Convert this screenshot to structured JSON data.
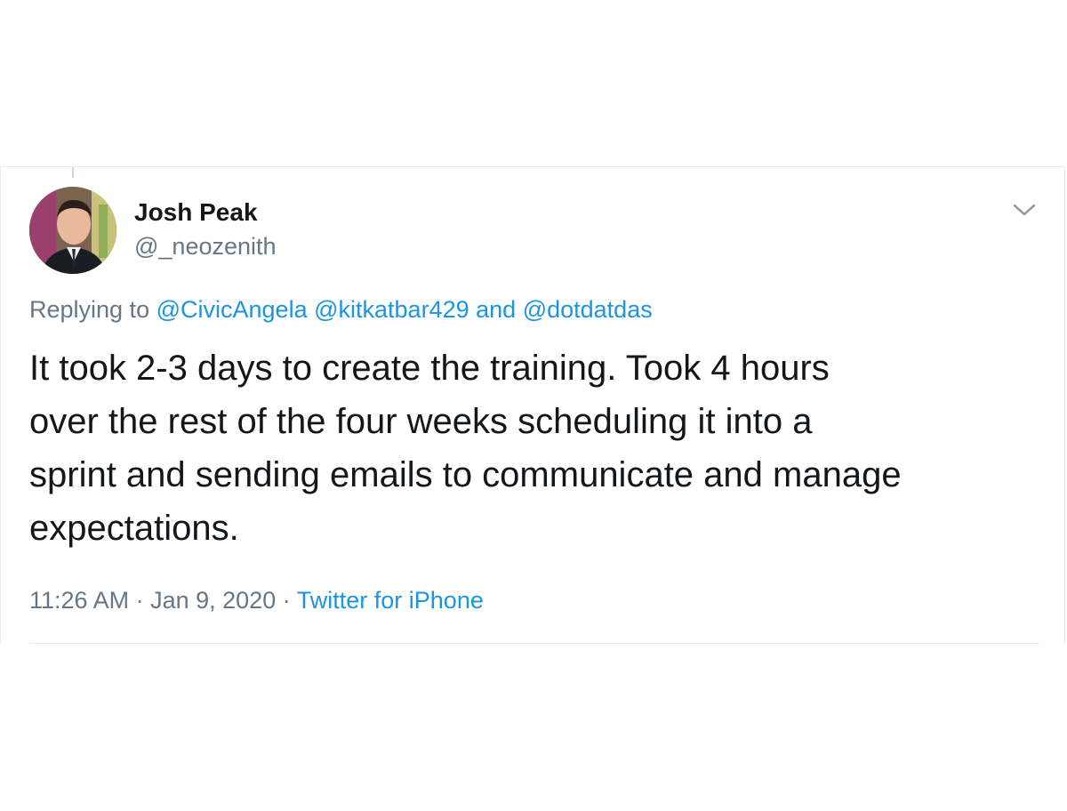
{
  "author": {
    "display_name": "Josh Peak",
    "handle": "@_neozenith",
    "avatar_icon": "user-avatar-photo"
  },
  "reply_context": {
    "prefix": "Replying to",
    "mentions": [
      "@CivicAngela",
      "@kitkatbar429",
      "@dotdatdas"
    ],
    "joiner": "and"
  },
  "tweet": {
    "text": "It took 2-3 days to create the training. Took 4 hours\nover the rest of the four weeks scheduling it into a\nsprint and sending emails to communicate and manage\nexpectations."
  },
  "meta": {
    "time": "11:26 AM",
    "separator": "·",
    "date": "Jan 9, 2020",
    "source": "Twitter for iPhone"
  },
  "icons": {
    "menu": "chevron-down-icon"
  },
  "colors": {
    "text": "#14171a",
    "secondary": "#657786",
    "link": "#1b95e0",
    "border": "#e6ecf0"
  }
}
